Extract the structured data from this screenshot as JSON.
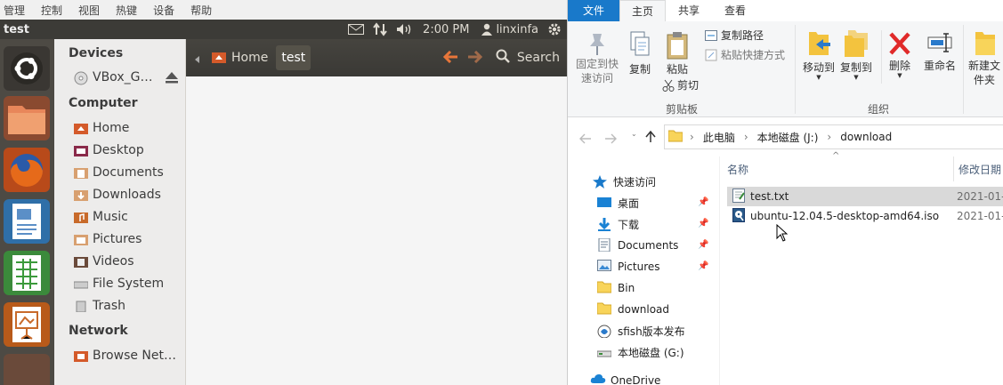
{
  "vbox_menu": [
    "管理",
    "控制",
    "视图",
    "热键",
    "设备",
    "帮助"
  ],
  "ubuntu": {
    "window_title": "test",
    "clock": "2:00 PM",
    "user": "linxinfa",
    "sidebar": {
      "devices_title": "Devices",
      "devices": [
        "VBox_G…"
      ],
      "computer_title": "Computer",
      "computer": [
        "Home",
        "Desktop",
        "Documents",
        "Downloads",
        "Music",
        "Pictures",
        "Videos",
        "File System",
        "Trash"
      ],
      "network_title": "Network",
      "network": [
        "Browse Net…"
      ]
    },
    "toolbar": {
      "crumb_home": "Home",
      "crumb_current": "test",
      "search_label": "Search"
    }
  },
  "explorer": {
    "tabs": [
      "文件",
      "主页",
      "共享",
      "查看"
    ],
    "ribbon": {
      "pin": "固定到快速访问",
      "copy": "复制",
      "paste": "粘贴",
      "copy_path": "复制路径",
      "paste_shortcut": "粘贴快捷方式",
      "cut": "剪切",
      "clipboard_group": "剪贴板",
      "move_to": "移动到",
      "copy_to": "复制到",
      "delete": "删除",
      "rename": "重命名",
      "organize_group": "组织",
      "new_folder": "新建文件夹"
    },
    "breadcrumb": [
      "此电脑",
      "本地磁盘 (J:)",
      "download"
    ],
    "nav": {
      "quick_access": "快速访问",
      "items": [
        "桌面",
        "下载",
        "Documents",
        "Pictures",
        "Bin",
        "download",
        "sfish版本发布",
        "本地磁盘 (G:)",
        "OneDrive"
      ]
    },
    "columns": {
      "name": "名称",
      "modified": "修改日期"
    },
    "files": [
      {
        "name": "test.txt",
        "date": "2021-01-"
      },
      {
        "name": "ubuntu-12.04.5-desktop-amd64.iso",
        "date": "2021-01-"
      }
    ]
  },
  "colors": {
    "ubuntu_panel": "#3c3b37",
    "launcher": "#4d4a44",
    "accent_orange": "#dd4814",
    "win_blue": "#1979ca"
  }
}
